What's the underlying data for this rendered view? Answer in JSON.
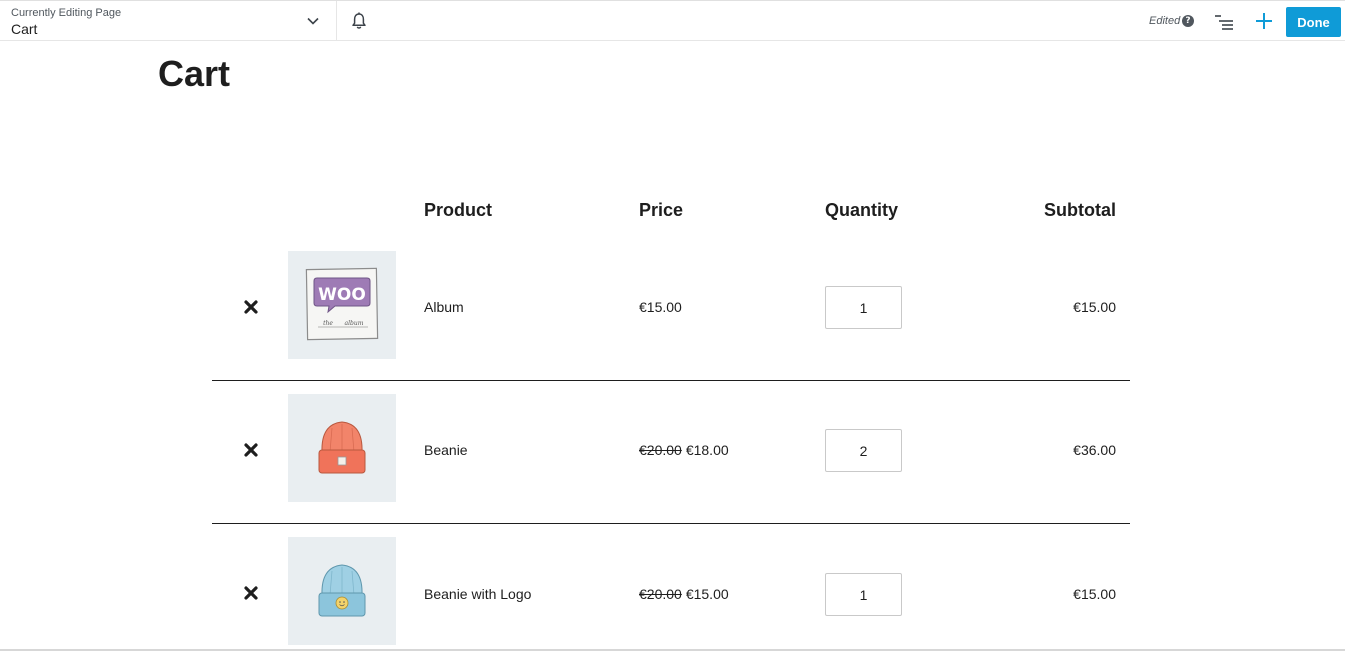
{
  "toolbar": {
    "currently_editing_label": "Currently Editing Page",
    "page_name": "Cart",
    "status": "Edited",
    "help_glyph": "?",
    "done_label": "Done",
    "accent_color": "#0f9bd7",
    "icons": [
      "chevron-down-icon",
      "bell-icon",
      "help-icon",
      "outline-icon",
      "plus-icon"
    ]
  },
  "page": {
    "title": "Cart"
  },
  "table": {
    "headers": {
      "product": "Product",
      "price": "Price",
      "quantity": "Quantity",
      "subtotal": "Subtotal"
    },
    "rows": [
      {
        "name": "Album",
        "old_price": "",
        "price": "€15.00",
        "quantity": "1",
        "subtotal": "€15.00",
        "image": "woo-album-thumbnail"
      },
      {
        "name": "Beanie",
        "old_price": "€20.00",
        "price": "€18.00",
        "quantity": "2",
        "subtotal": "€36.00",
        "image": "orange-beanie-thumbnail"
      },
      {
        "name": "Beanie with Logo",
        "old_price": "€20.00",
        "price": "€15.00",
        "quantity": "1",
        "subtotal": "€15.00",
        "image": "blue-beanie-logo-thumbnail"
      }
    ],
    "album_art_text": {
      "logo": "WOO",
      "caption_1": "the",
      "caption_2": "album"
    }
  }
}
